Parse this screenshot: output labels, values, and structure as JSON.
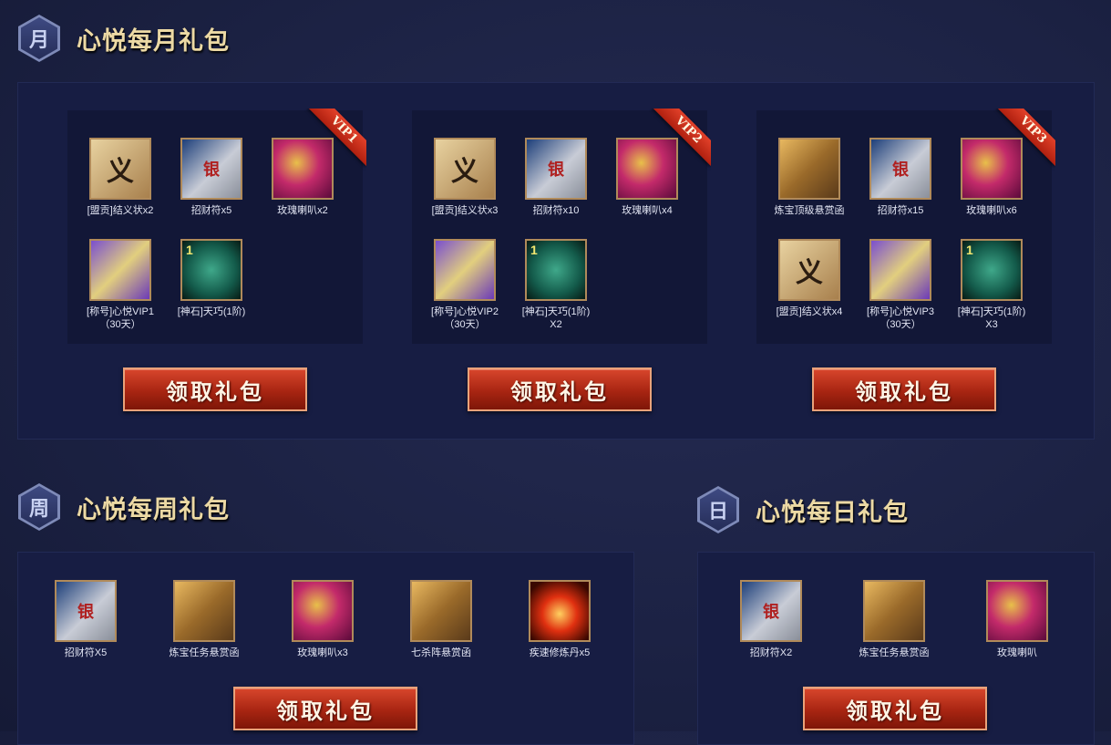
{
  "monthly": {
    "hex": "月",
    "title": "心悦每月礼包",
    "button": "领取礼包",
    "cards": [
      {
        "vip": "VIP1",
        "items": [
          {
            "icon": "letter-icon",
            "glyph": "义",
            "label": "[盟贡]结义状x2"
          },
          {
            "icon": "money-scroll-icon",
            "glyph": "银",
            "label": "招财符x5"
          },
          {
            "icon": "rose-horn-icon",
            "glyph": "",
            "label": "玫瑰喇叭x2"
          },
          {
            "icon": "title-scroll-icon",
            "glyph": "",
            "label": "[称号]心悦VIP1\n（30天）"
          },
          {
            "icon": "divine-stone-icon",
            "glyph": "1",
            "label": "[神石]天巧(1阶)"
          }
        ]
      },
      {
        "vip": "VIP2",
        "items": [
          {
            "icon": "letter-icon",
            "glyph": "义",
            "label": "[盟贡]结义状x3"
          },
          {
            "icon": "money-scroll-icon",
            "glyph": "银",
            "label": "招财符x10"
          },
          {
            "icon": "rose-horn-icon",
            "glyph": "",
            "label": "玫瑰喇叭x4"
          },
          {
            "icon": "title-scroll-icon",
            "glyph": "",
            "label": "[称号]心悦VIP2\n（30天）"
          },
          {
            "icon": "divine-stone-icon",
            "glyph": "1",
            "label": "[神石]天巧(1阶)\nX2"
          }
        ]
      },
      {
        "vip": "VIP3",
        "items": [
          {
            "icon": "treasure-bag-icon",
            "glyph": "",
            "label": "炼宝顶级悬赏函"
          },
          {
            "icon": "money-scroll-icon",
            "glyph": "银",
            "label": "招财符x15"
          },
          {
            "icon": "rose-horn-icon",
            "glyph": "",
            "label": "玫瑰喇叭x6"
          },
          {
            "icon": "letter-icon",
            "glyph": "义",
            "label": "[盟贡]结义状x4"
          },
          {
            "icon": "title-scroll-icon",
            "glyph": "",
            "label": "[称号]心悦VIP3\n（30天）"
          },
          {
            "icon": "divine-stone-icon",
            "glyph": "1",
            "label": "[神石]天巧(1阶)\nX3"
          }
        ]
      }
    ]
  },
  "weekly": {
    "hex": "周",
    "title": "心悦每周礼包",
    "button": "领取礼包",
    "items": [
      {
        "icon": "money-scroll-icon",
        "glyph": "银",
        "label": "招财符X5"
      },
      {
        "icon": "treasure-bag-icon",
        "glyph": "",
        "label": "炼宝任务悬赏函"
      },
      {
        "icon": "rose-horn-icon",
        "glyph": "",
        "label": "玫瑰喇叭x3"
      },
      {
        "icon": "treasure-bag-icon",
        "glyph": "",
        "label": "七杀阵悬赏函"
      },
      {
        "icon": "fire-pill-icon",
        "glyph": "",
        "label": "疾速修炼丹x5"
      }
    ]
  },
  "daily": {
    "hex": "日",
    "title": "心悦每日礼包",
    "button": "领取礼包",
    "items": [
      {
        "icon": "money-scroll-icon",
        "glyph": "银",
        "label": "招财符X2"
      },
      {
        "icon": "treasure-bag-icon",
        "glyph": "",
        "label": "炼宝任务悬赏函"
      },
      {
        "icon": "rose-horn-icon",
        "glyph": "",
        "label": "玫瑰喇叭"
      }
    ]
  }
}
